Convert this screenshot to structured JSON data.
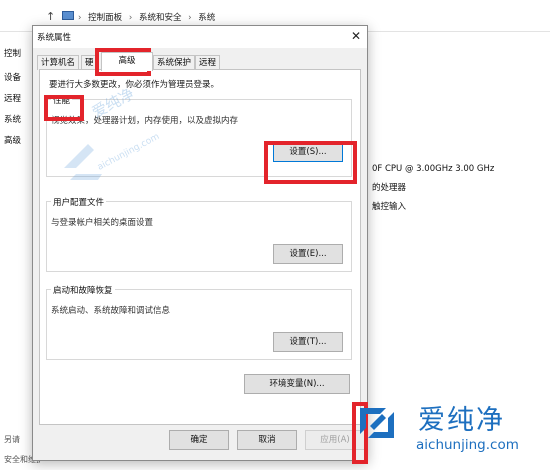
{
  "background": {
    "breadcrumb": [
      "控制面板",
      "系统和安全",
      "系统"
    ],
    "left_links": [
      "控制",
      "设备",
      "远程",
      "系统",
      "高级"
    ],
    "bottom_left": [
      "另请",
      "安全和维护"
    ],
    "right_text": [
      "0F CPU @ 3.00GHz   3.00 GHz",
      "的处理器",
      "触控输入"
    ]
  },
  "dialog": {
    "title": "系统属性",
    "tabs": [
      "计算机名",
      "硬",
      "高级",
      "系统保护",
      "远程"
    ],
    "admin_note": "要进行大多数更改，你必须作为管理员登录。",
    "performance": {
      "title": "性能",
      "desc": "视觉效果，处理器计划，内存使用，以及虚拟内存",
      "button": "设置(S)..."
    },
    "user_profiles": {
      "title": "用户配置文件",
      "desc": "与登录帐户相关的桌面设置",
      "button": "设置(E)..."
    },
    "startup": {
      "title": "启动和故障恢复",
      "desc": "系统启动、系统故障和调试信息",
      "button": "设置(T)..."
    },
    "env_button": "环境变量(N)...",
    "ok": "确定",
    "cancel": "取消",
    "apply": "应用(A)"
  },
  "watermark": {
    "text": "爱纯净",
    "url": "aichunjing.com"
  },
  "colors": {
    "highlight": "#e3242b",
    "watermark": "#1d6fbf",
    "dialog_bg": "#f0f0f0"
  }
}
